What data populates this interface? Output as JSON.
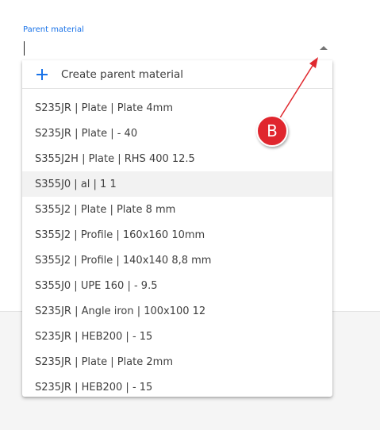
{
  "field": {
    "label": "Parent material",
    "value": ""
  },
  "dropdown": {
    "create_label": "Create parent material",
    "highlighted_index": 3,
    "items": [
      "S235JR | Plate | Plate 4mm",
      "S235JR | Plate | - 40",
      "S355J2H | Plate | RHS 400 12.5",
      "S355J0 | al | 1 1",
      "S355J2 | Plate | Plate 8 mm",
      "S355J2 | Profile | 160x160 10mm",
      "S355J2 | Profile | 140x140 8,8 mm",
      "S355J0 | UPE 160 | - 9.5",
      "S235JR | Angle iron | 100x100 12",
      "S235JR | HEB200 | - 15",
      "S235JR | Plate | Plate 2mm",
      "S235JR | HEB200 | - 15"
    ]
  },
  "annotation": {
    "badge": "B",
    "color": "#e0282e"
  },
  "colors": {
    "accent": "#1a73e8",
    "highlight": "#f2f2f2"
  }
}
